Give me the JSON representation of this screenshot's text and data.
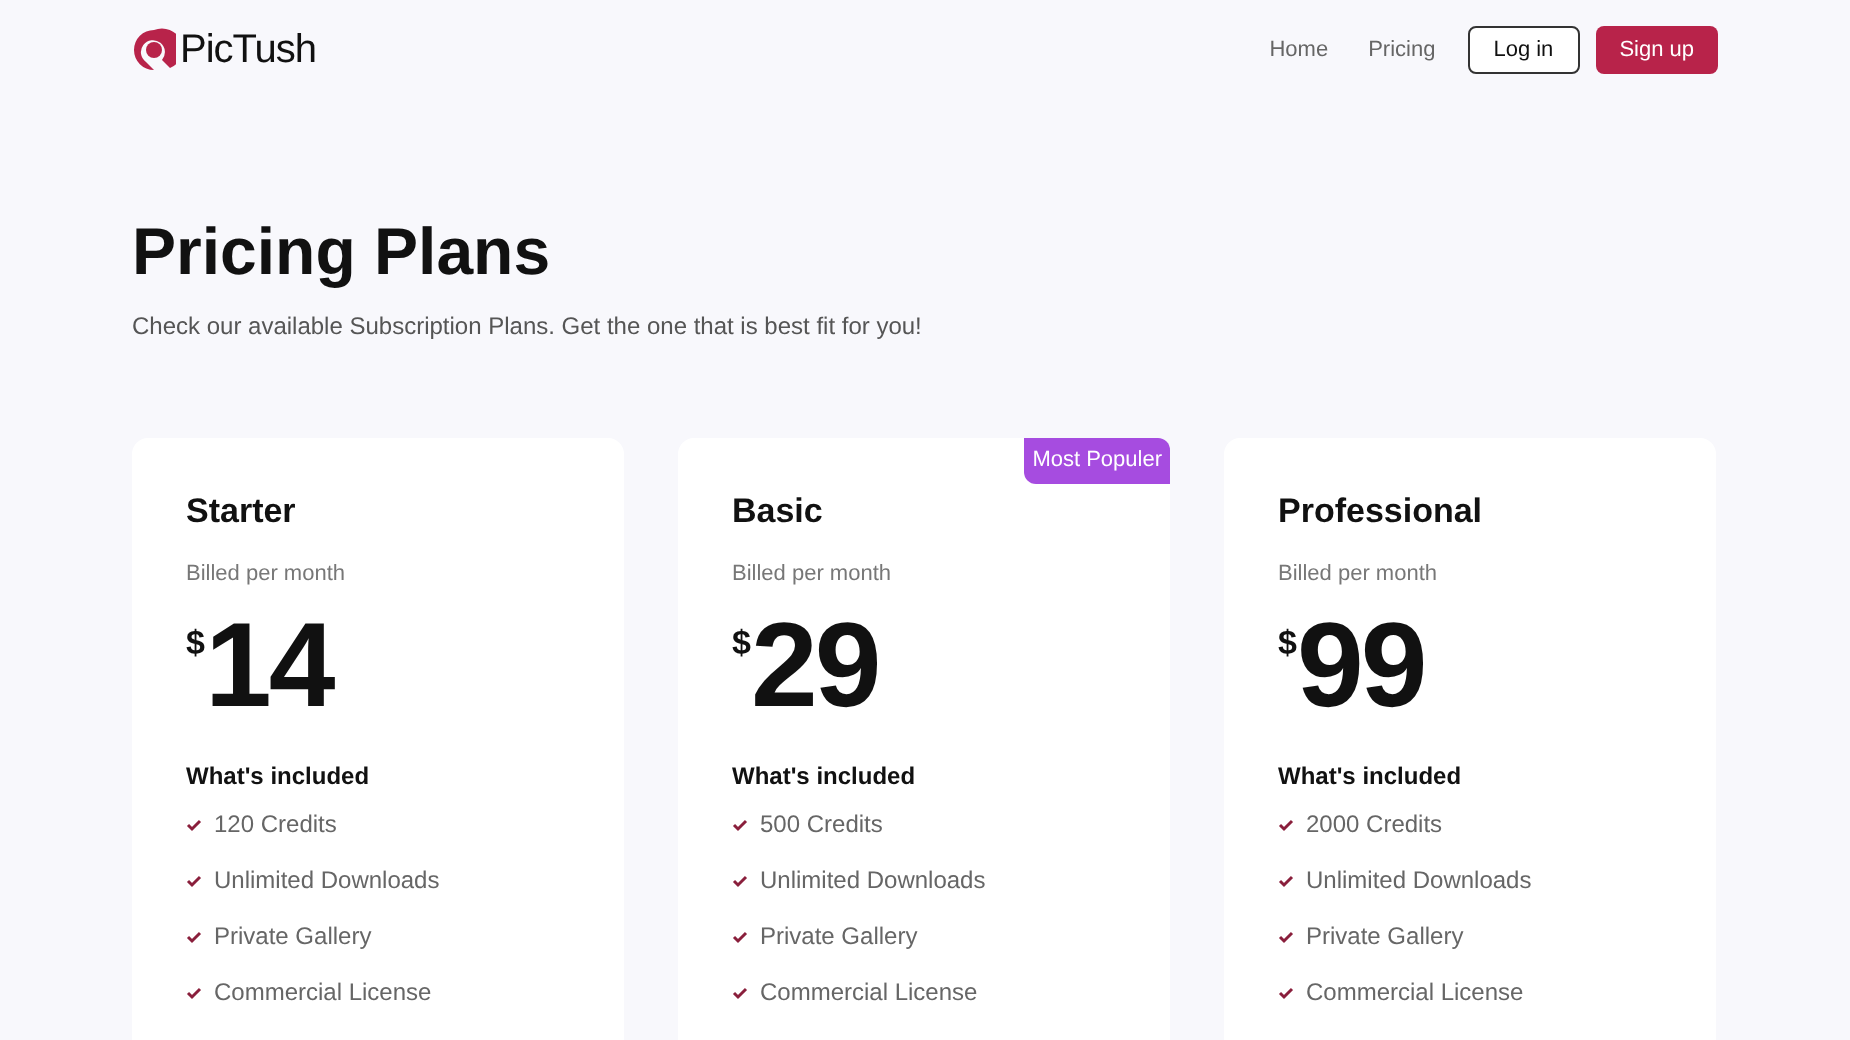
{
  "brand": {
    "name": "PicTush"
  },
  "nav": {
    "links": [
      "Home",
      "Pricing"
    ],
    "login": "Log in",
    "signup": "Sign up"
  },
  "hero": {
    "title": "Pricing Plans",
    "subtitle": "Check our available Subscription Plans. Get the one that is best fit for you!"
  },
  "plans": [
    {
      "name": "Starter",
      "billing": "Billed per month",
      "currency": "$",
      "price": "14",
      "features_title": "What's included",
      "features": [
        "120 Credits",
        "Unlimited Downloads",
        "Private Gallery",
        "Commercial License"
      ]
    },
    {
      "name": "Basic",
      "badge": "Most Populer",
      "billing": "Billed per month",
      "currency": "$",
      "price": "29",
      "features_title": "What's included",
      "features": [
        "500 Credits",
        "Unlimited Downloads",
        "Private Gallery",
        "Commercial License"
      ]
    },
    {
      "name": "Professional",
      "billing": "Billed per month",
      "currency": "$",
      "price": "99",
      "features_title": "What's included",
      "features": [
        "2000 Credits",
        "Unlimited Downloads",
        "Private Gallery",
        "Commercial License"
      ]
    }
  ]
}
